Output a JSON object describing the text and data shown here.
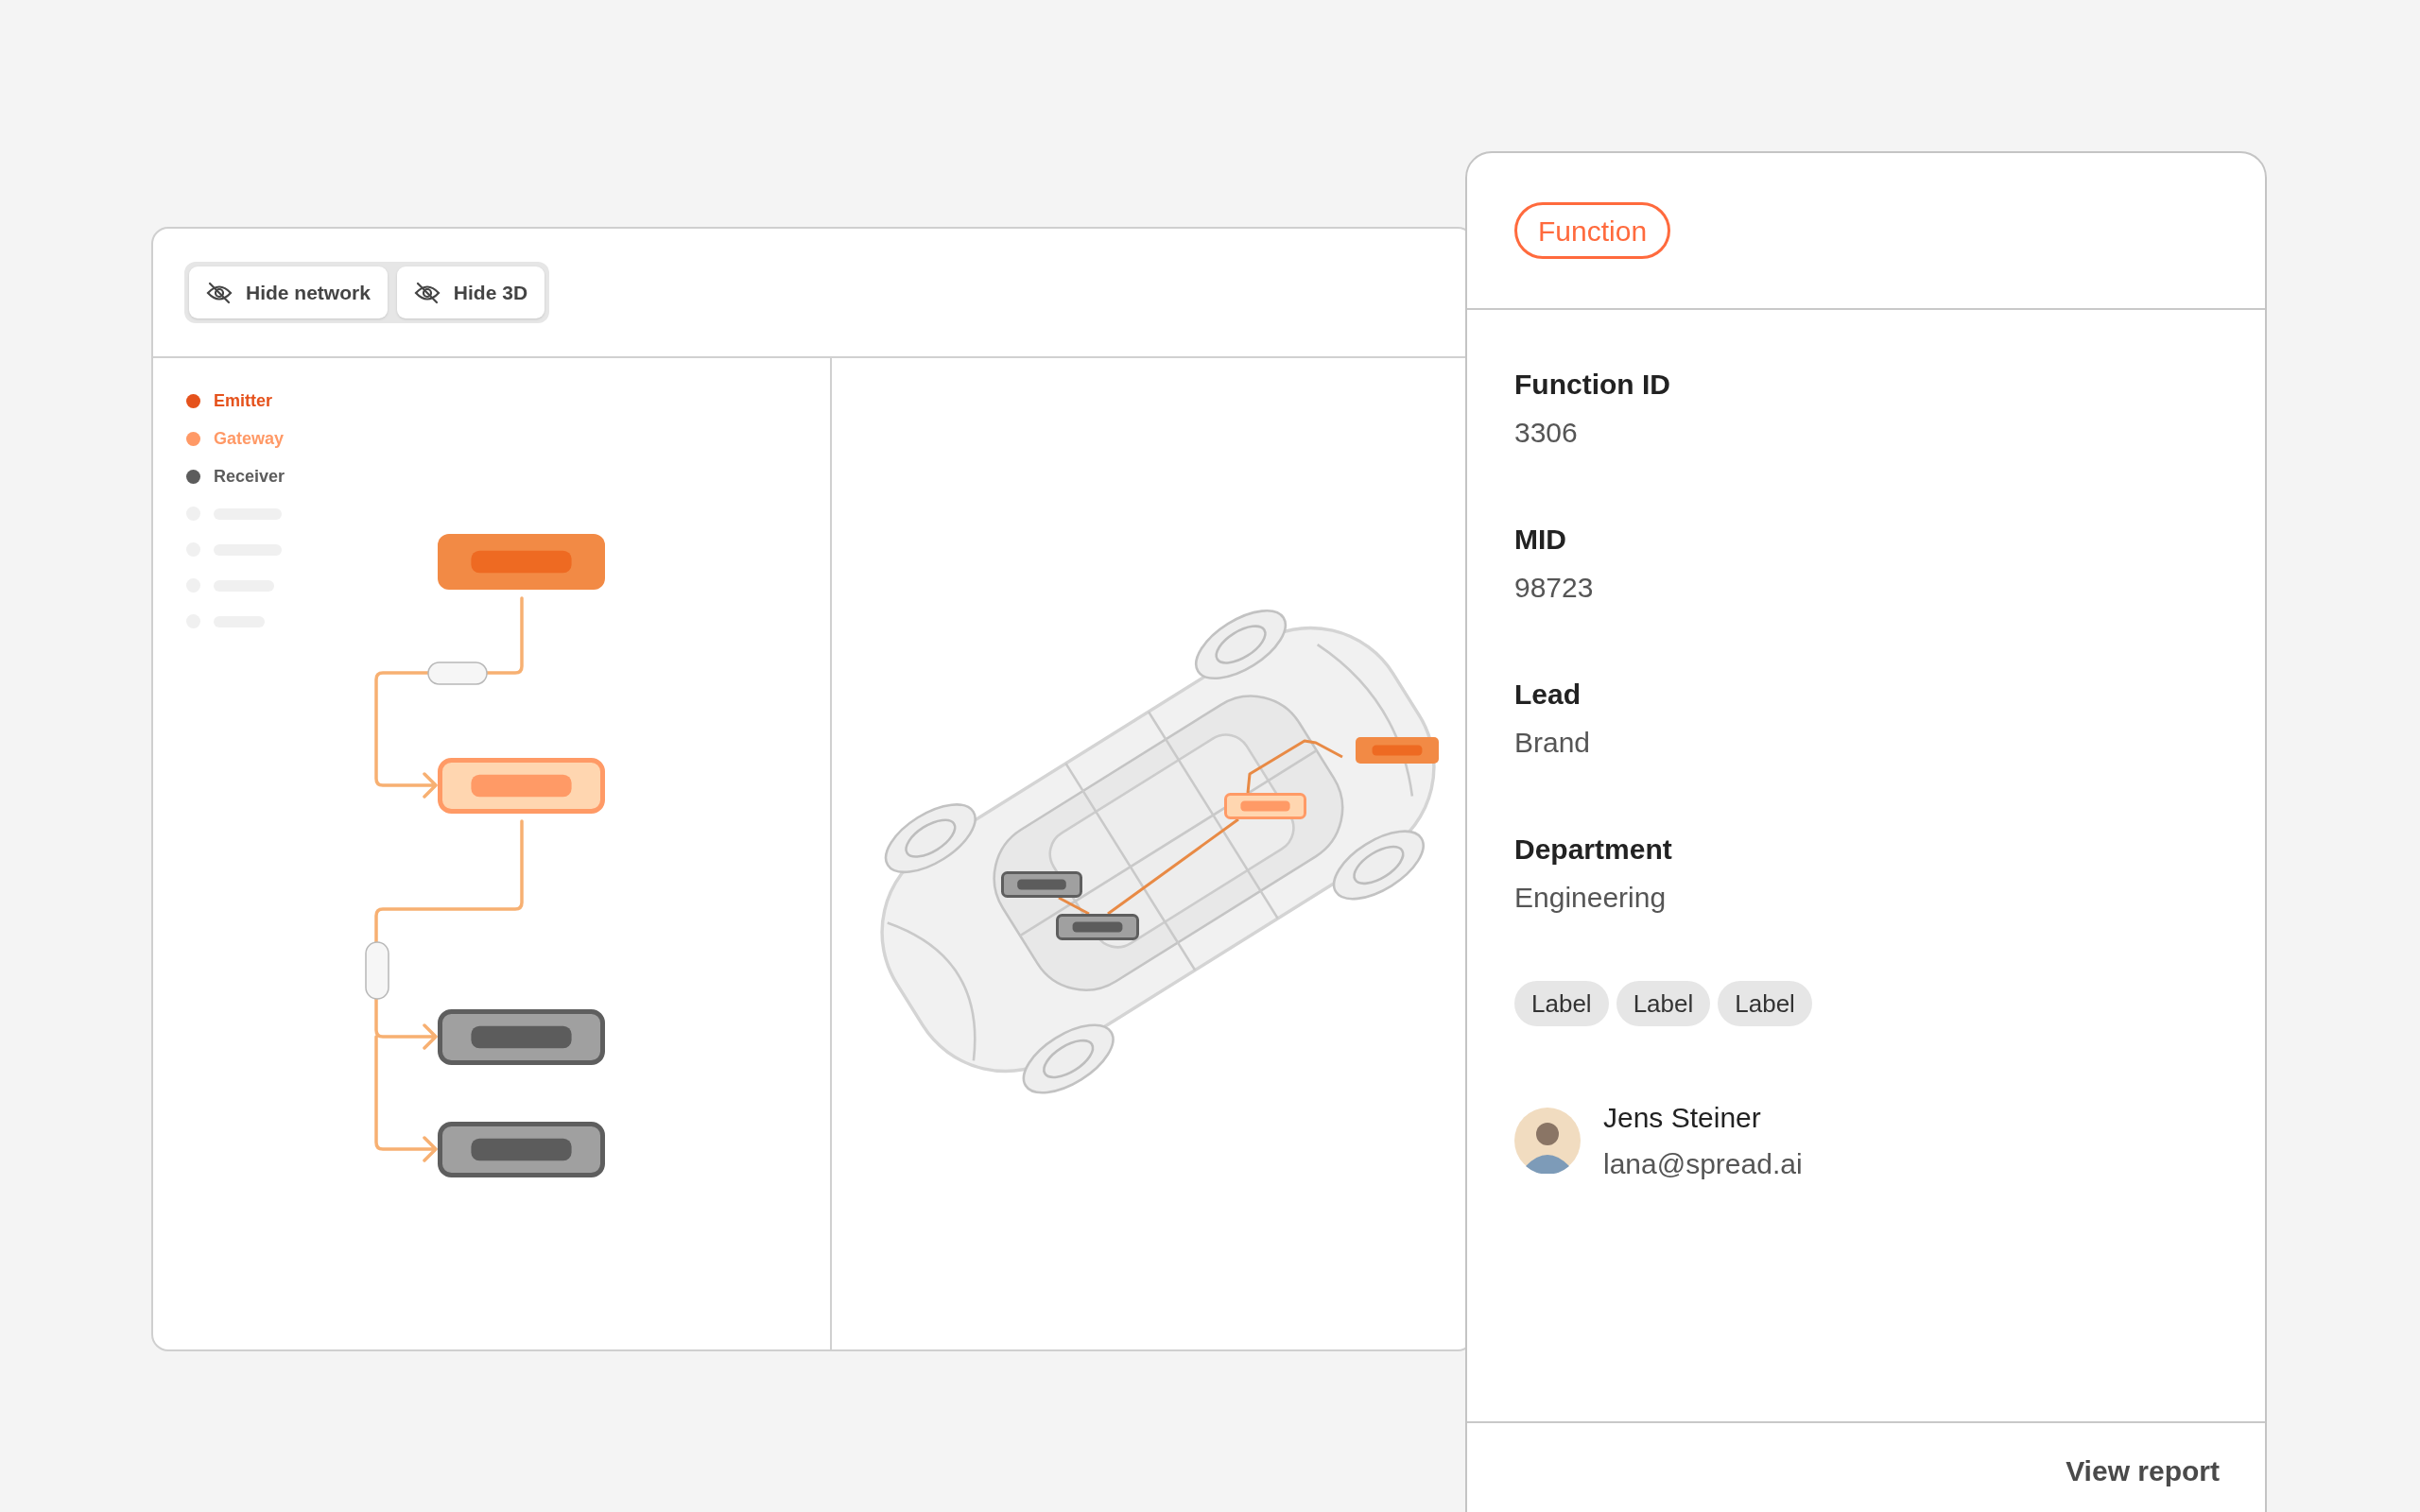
{
  "toolbar": {
    "buttons": [
      {
        "label": "Hide network"
      },
      {
        "label": "Hide 3D"
      }
    ]
  },
  "legend": [
    {
      "label": "Emitter",
      "color": "#e5521c"
    },
    {
      "label": "Gateway",
      "color": "#ff9966"
    },
    {
      "label": "Receiver",
      "color": "#5c5c5c"
    }
  ],
  "network_nodes": [
    {
      "kind": "emitter"
    },
    {
      "kind": "gateway"
    },
    {
      "kind": "receiver"
    },
    {
      "kind": "receiver"
    }
  ],
  "car_nodes": [
    {
      "kind": "receiver"
    },
    {
      "kind": "receiver"
    },
    {
      "kind": "gateway"
    },
    {
      "kind": "emitter"
    }
  ],
  "details": {
    "badge": "Function",
    "fields": [
      {
        "label": "Function ID",
        "value": "3306"
      },
      {
        "label": "MID",
        "value": "98723"
      },
      {
        "label": "Lead",
        "value": "Brand"
      },
      {
        "label": "Department",
        "value": "Engineering"
      }
    ],
    "labels": [
      "Label",
      "Label",
      "Label"
    ],
    "person": {
      "name": "Jens Steiner",
      "email": "lana@spread.ai"
    },
    "footer_link": "View report"
  }
}
